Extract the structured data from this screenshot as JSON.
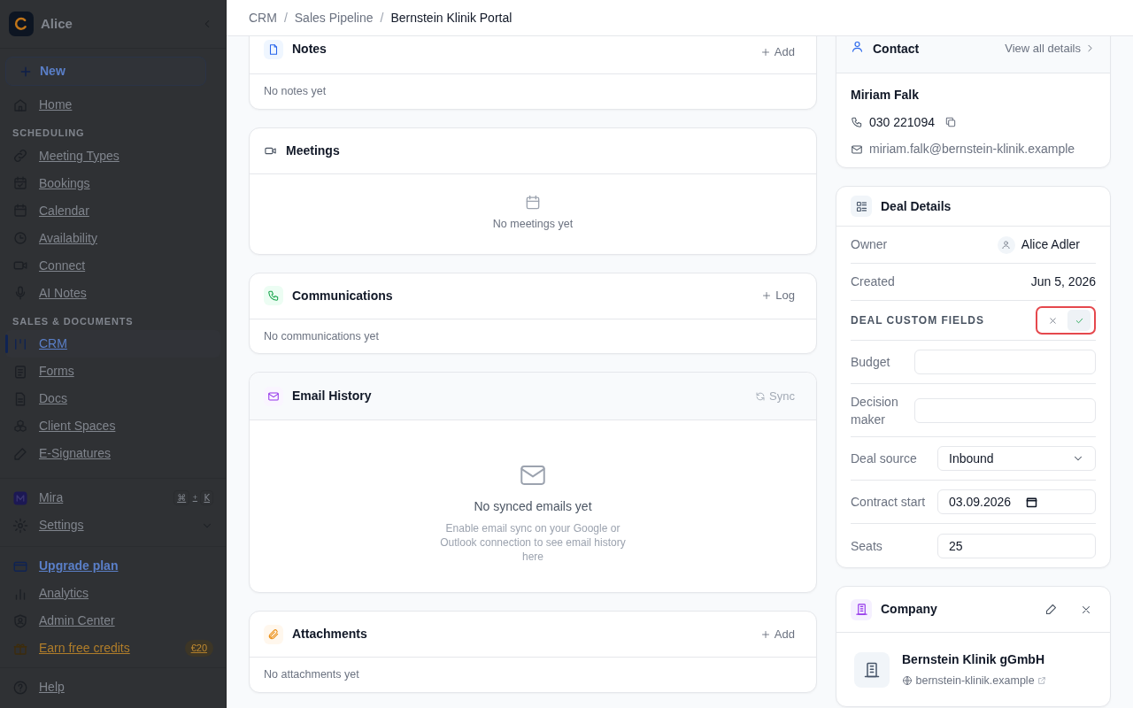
{
  "sidebar": {
    "workspace": "Alice",
    "new_button": "New",
    "groups": [
      {
        "items": [
          {
            "label": "Home",
            "selected": false
          }
        ]
      },
      {
        "heading": "SCHEDULING",
        "items": [
          {
            "label": "Meeting Types",
            "selected": false
          },
          {
            "label": "Bookings",
            "selected": false
          },
          {
            "label": "Calendar",
            "selected": false
          },
          {
            "label": "Availability",
            "selected": false
          },
          {
            "label": "Connect",
            "selected": false
          },
          {
            "label": "AI Notes",
            "selected": false
          }
        ]
      },
      {
        "heading": "SALES & DOCUMENTS",
        "items": [
          {
            "label": "CRM",
            "selected": true
          },
          {
            "label": "Forms",
            "selected": false
          },
          {
            "label": "Docs",
            "selected": false
          },
          {
            "label": "Client Spaces",
            "selected": false
          },
          {
            "label": "E-Signatures",
            "selected": false
          }
        ]
      }
    ],
    "assistant": {
      "label": "Mira",
      "keys": [
        "⌘",
        "+",
        "K"
      ]
    },
    "settings": {
      "label": "Settings",
      "expanded": false
    },
    "footer": [
      {
        "label": "Upgrade plan",
        "kind": "upgrade"
      },
      {
        "label": "Analytics",
        "kind": "plain"
      },
      {
        "label": "Admin Center",
        "kind": "plain"
      },
      {
        "label": "Earn free credits",
        "kind": "credits",
        "badge": "€20"
      },
      {
        "label": "Help",
        "kind": "help"
      }
    ]
  },
  "breadcrumb": {
    "separator": "/",
    "items": [
      {
        "label": "CRM",
        "current": false
      },
      {
        "label": "Sales Pipeline",
        "current": false
      },
      {
        "label": "Bernstein Klinik Portal",
        "current": true
      }
    ]
  },
  "left_panels": [
    {
      "title": "Notes",
      "kind": "list",
      "action": {
        "label": "Add",
        "disabled": false
      },
      "empty": "No notes yet"
    },
    {
      "title": "Meetings",
      "kind": "empty_state",
      "empty": "No meetings yet"
    },
    {
      "title": "Communications",
      "kind": "list",
      "action": {
        "label": "Log",
        "disabled": false
      },
      "empty": "No communications yet"
    },
    {
      "title": "Email History",
      "kind": "big_empty",
      "action": {
        "label": "Sync",
        "disabled": true
      },
      "empty": "No synced emails yet",
      "hint": "Enable email sync on your Google or Outlook connection to see email history here"
    },
    {
      "title": "Attachments",
      "kind": "list",
      "action": {
        "label": "Add",
        "disabled": false
      },
      "empty": "No attachments yet"
    }
  ],
  "contact": {
    "title": "Contact",
    "link": "View all details",
    "name": "Miriam Falk",
    "phone": "030 221094",
    "email": "miriam.falk@bernstein-klinik.example"
  },
  "deal_details": {
    "title": "Deal Details",
    "rows": [
      {
        "label": "Owner",
        "value": "Alice Adler",
        "kind": "person"
      },
      {
        "label": "Created",
        "value": "Jun 5, 2026",
        "kind": "text"
      }
    ],
    "custom_fields": {
      "heading": "DEAL CUSTOM FIELDS",
      "editing": true,
      "fields": [
        {
          "label": "Budget",
          "kind": "text"
        },
        {
          "label": "Decision maker",
          "kind": "text"
        },
        {
          "label": "Deal source",
          "kind": "select",
          "value": "Inbound"
        },
        {
          "label": "Contract start",
          "kind": "date",
          "value": "03.09.2026"
        },
        {
          "label": "Seats",
          "kind": "number",
          "value": "25"
        }
      ]
    }
  },
  "company": {
    "title": "Company",
    "name": "Bernstein Klinik gGmbH",
    "website": "bernstein-klinik.example"
  }
}
